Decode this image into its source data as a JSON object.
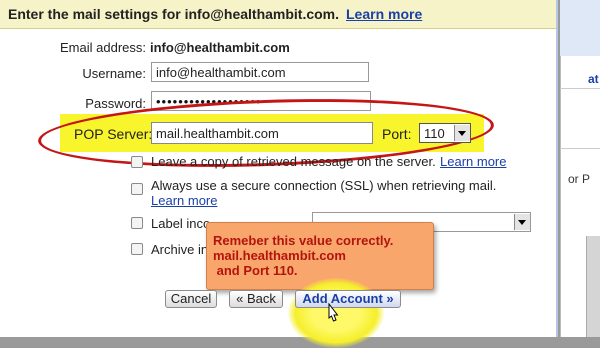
{
  "header": {
    "title": "Enter the mail settings for info@healthambit.com.",
    "learn_more": "Learn more"
  },
  "form": {
    "email_label": "Email address:",
    "email_value": "info@healthambit.com",
    "username_label": "Username:",
    "username_value": "info@healthambit.com",
    "password_label": "Password:",
    "password_value": "•••••••••••••••••••",
    "pop_label": "POP Server:",
    "pop_value": "mail.healthambit.com",
    "port_label": "Port:",
    "port_value": "110"
  },
  "options": {
    "leave_copy": "Leave a copy of retrieved message on the server.",
    "leave_copy_link": "Learn more",
    "ssl": "Always use a secure connection (SSL) when retrieving mail.",
    "ssl_link": "Learn more",
    "label_incoming": "Label inco",
    "archive": "Archive in"
  },
  "note": {
    "line1": "Remeber this value correctly.",
    "line2": "mail.healthambit.com",
    "line3": " and Port 110."
  },
  "buttons": {
    "cancel": "Cancel",
    "back": "« Back",
    "add": "Add Account »"
  },
  "background": {
    "text1": "at",
    "text2": "or P"
  },
  "colors": {
    "link": "#1a3fa8",
    "highlight": "#f9f41a",
    "annotation_red": "#c41616",
    "note_bg": "#f9a66c"
  }
}
